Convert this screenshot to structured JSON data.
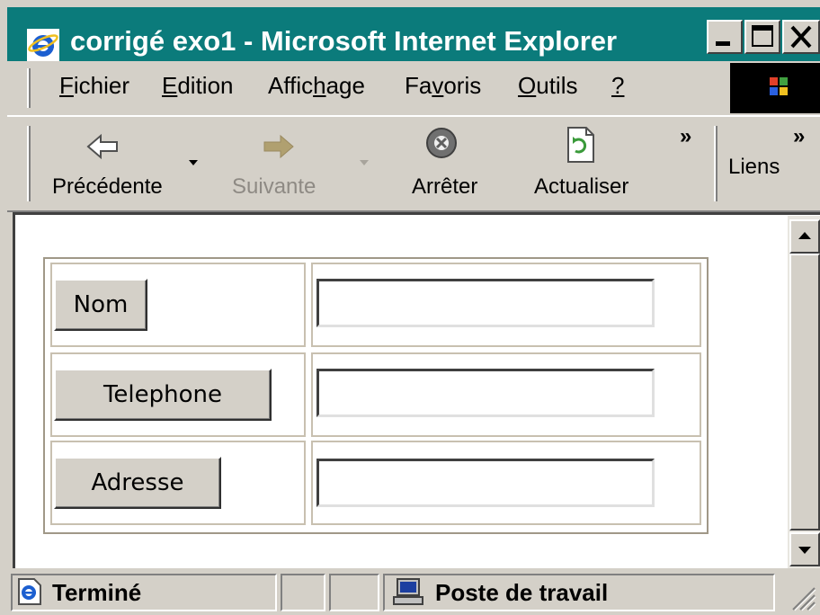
{
  "window": {
    "title": "corrigé exo1 - Microsoft Internet Explorer",
    "title_icon": "ie-icon",
    "controls": [
      "minimize-icon",
      "maximize-icon",
      "close-icon"
    ]
  },
  "menu": {
    "items": [
      {
        "label": "Fichier",
        "accel": "F",
        "rest": "ichier"
      },
      {
        "label": "Edition",
        "accel": "E",
        "rest": "dition"
      },
      {
        "label": "Affichage",
        "pre": "Affic",
        "accel": "h",
        "rest": "age"
      },
      {
        "label": "Favoris",
        "pre": "Fa",
        "accel": "v",
        "rest": "oris"
      },
      {
        "label": "Outils",
        "accel": "O",
        "rest": "utils"
      },
      {
        "label": "?",
        "accel": "?",
        "rest": ""
      }
    ]
  },
  "toolbar": {
    "back_label": "Précédente",
    "forward_label": "Suivante",
    "stop_label": "Arrêter",
    "refresh_label": "Actualiser",
    "links_label": "Liens",
    "chevron": "»"
  },
  "form": {
    "rows": [
      {
        "button": "Nom",
        "value": ""
      },
      {
        "button": "Telephone",
        "value": ""
      },
      {
        "button": "Adresse",
        "value": ""
      }
    ]
  },
  "status": {
    "text": "Terminé",
    "zone": "Poste de travail"
  },
  "colors": {
    "titlebar": "#0b7b7b",
    "chrome": "#d4d0c8",
    "disabled_text": "#8e8a84"
  }
}
